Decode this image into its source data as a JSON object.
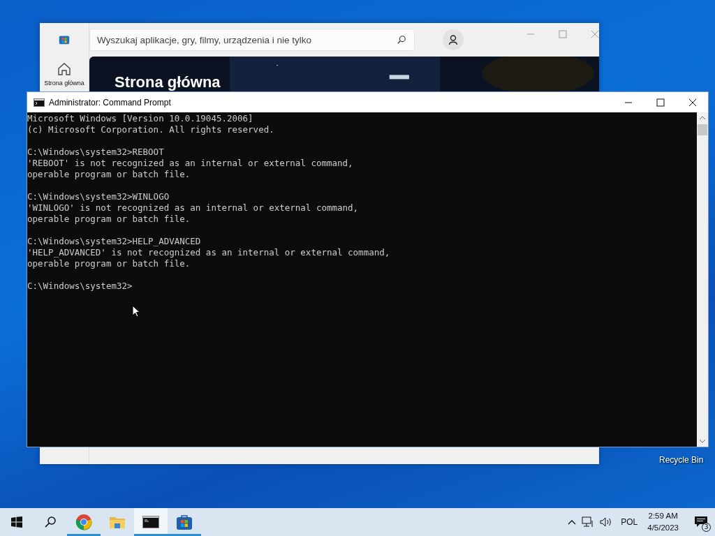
{
  "store_window": {
    "search": {
      "placeholder": "Wyszukaj aplikacje, gry, filmy, urządzenia i nie tylko"
    },
    "sidebar": {
      "items": [
        {
          "label": "Strona główna",
          "selected": true
        }
      ]
    },
    "hero": {
      "title": "Strona główna"
    }
  },
  "cmd_window": {
    "title": "Administrator:  Command Prompt",
    "blocks": [
      [
        "Microsoft Windows [Version 10.0.19045.2006]",
        "(c) Microsoft Corporation. All rights reserved."
      ],
      [
        "C:\\Windows\\system32>REBOOT",
        "'REBOOT' is not recognized as an internal or external command,",
        "operable program or batch file."
      ],
      [
        "C:\\Windows\\system32>WINLOGO",
        "'WINLOGO' is not recognized as an internal or external command,",
        "operable program or batch file."
      ],
      [
        "C:\\Windows\\system32>HELP_ADVANCED",
        "'HELP_ADVANCED' is not recognized as an internal or external command,",
        "operable program or batch file."
      ],
      [
        "C:\\Windows\\system32>"
      ]
    ]
  },
  "desktop_icons": [
    {
      "label": "Recycle Bin"
    }
  ],
  "taskbar": {
    "apps": [
      {
        "kind": "chrome",
        "running": true,
        "selected": false
      },
      {
        "kind": "explorer",
        "running": false,
        "selected": false
      },
      {
        "kind": "cmd",
        "running": true,
        "selected": true
      },
      {
        "kind": "store",
        "running": true,
        "selected": false
      }
    ],
    "language": "POL",
    "time": "2:59 AM",
    "date": "4/5/2023",
    "notifications": "3"
  }
}
